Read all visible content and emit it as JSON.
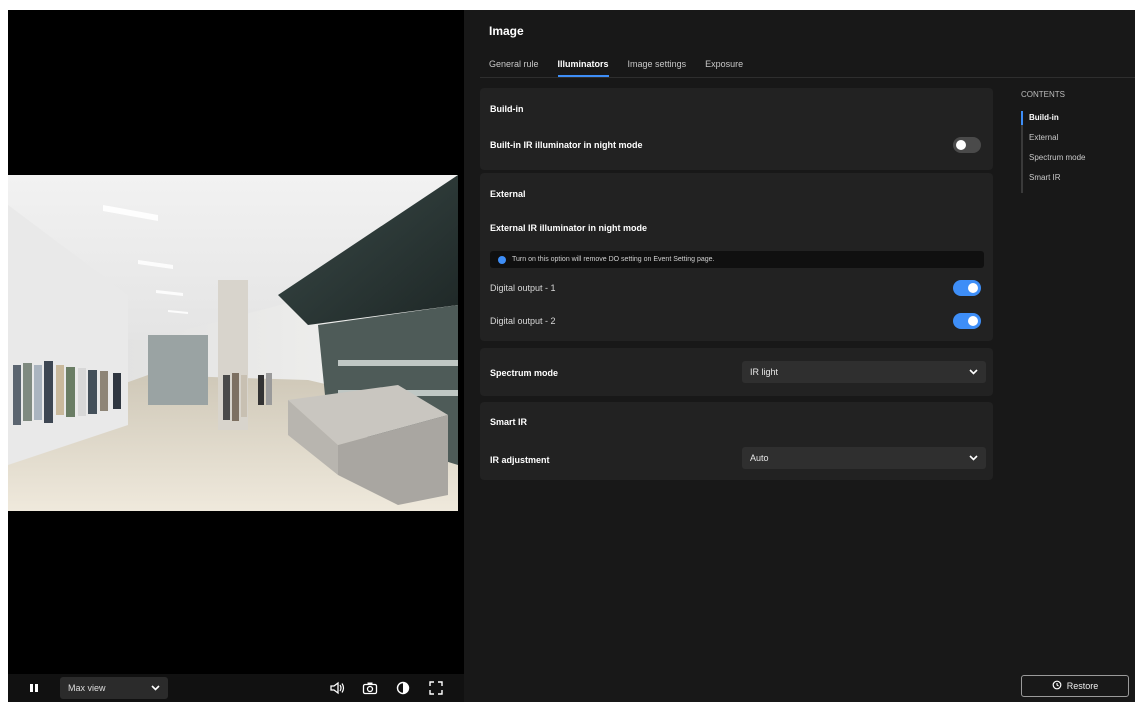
{
  "video": {
    "view_mode": "Max view"
  },
  "settings": {
    "title": "Image",
    "tabs": [
      {
        "label": "General rule"
      },
      {
        "label": "Illuminators"
      },
      {
        "label": "Image settings"
      },
      {
        "label": "Exposure"
      }
    ],
    "active_tab": "Illuminators",
    "builtin": {
      "heading": "Build-in",
      "ir_label": "Built-in IR illuminator in night mode",
      "ir_enabled": false
    },
    "external": {
      "heading": "External",
      "ir_label": "External IR illuminator in night mode",
      "info": "Turn on this option will remove DO setting on Event Setting page.",
      "outputs": [
        {
          "label": "Digital output - 1",
          "enabled": true
        },
        {
          "label": "Digital output - 2",
          "enabled": true
        }
      ]
    },
    "spectrum": {
      "label": "Spectrum mode",
      "value": "IR light"
    },
    "smart_ir": {
      "heading": "Smart IR",
      "adjustment_label": "IR adjustment",
      "adjustment_value": "Auto"
    },
    "contents": {
      "title": "CONTENTS",
      "items": [
        {
          "label": "Build-in"
        },
        {
          "label": "External"
        },
        {
          "label": "Spectrum mode"
        },
        {
          "label": "Smart IR"
        }
      ],
      "active": "Build-in"
    },
    "restore_label": "Restore"
  },
  "colors": {
    "accent": "#3e8ef7",
    "panel": "#222222",
    "background": "#181818"
  }
}
